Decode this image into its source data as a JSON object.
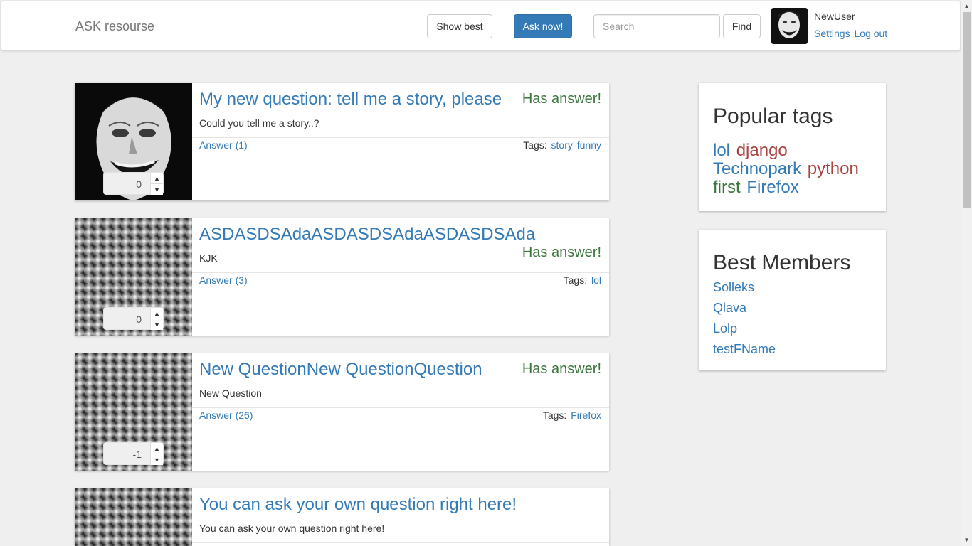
{
  "header": {
    "brand": "ASK resourse",
    "show_best_label": "Show best",
    "ask_label": "Ask now!",
    "search_placeholder": "Search",
    "find_label": "Find",
    "username": "NewUser",
    "settings_label": "Settings",
    "logout_label": "Log out"
  },
  "questions": [
    {
      "title": "My new question: tell me a story, please",
      "text": "Could you tell me a story..?",
      "status": "Has answer!",
      "answers": "Answer (1)",
      "tags_label": "Tags:",
      "tags": [
        "story",
        "funny"
      ],
      "rating": "0",
      "image": "joker-photo"
    },
    {
      "title": "ASDASDSAdaASDASDSAdaASDASDSAda",
      "text": "KJK",
      "status": "Has answer!",
      "answers": "Answer (3)",
      "tags_label": "Tags:",
      "tags": [
        "lol"
      ],
      "rating": "0",
      "image": "texture-photo"
    },
    {
      "title": "New QuestionNew QuestionQuestion",
      "text": "New Question",
      "status": "Has answer!",
      "answers": "Answer (26)",
      "tags_label": "Tags:",
      "tags": [
        "Firefox"
      ],
      "rating": "-1",
      "image": "texture-photo"
    },
    {
      "title": "You can ask your own question right here!",
      "text": "You can ask your own question right here!",
      "image": "texture-photo"
    }
  ],
  "sidebar": {
    "popular_tags_title": "Popular tags",
    "tags": [
      {
        "name": "lol",
        "color": "#337ab7"
      },
      {
        "name": "django",
        "color": "#a94442"
      },
      {
        "name": "Technopark",
        "color": "#337ab7"
      },
      {
        "name": "python",
        "color": "#a94442"
      },
      {
        "name": "first",
        "color": "#3c763d"
      },
      {
        "name": "Firefox",
        "color": "#337ab7"
      }
    ],
    "best_members_title": "Best Members",
    "members": [
      "Solleks",
      "Qlava",
      "Lolp",
      "testFName"
    ]
  },
  "colors": {
    "link": "#337ab7",
    "primary_button": "#337ab7",
    "has_answer": "#3c763d",
    "tag_red": "#a94442",
    "background": "#efefef"
  },
  "icons": [
    "spinner-up-icon",
    "spinner-down-icon",
    "scroll-up-icon",
    "scroll-down-icon"
  ]
}
